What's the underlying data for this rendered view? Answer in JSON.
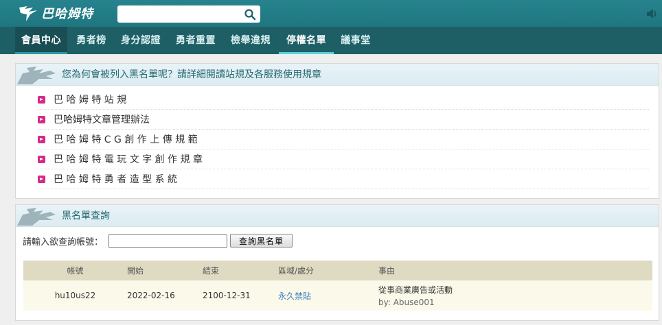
{
  "header": {
    "logo_text": "巴哈姆特",
    "search_placeholder": "",
    "search_value": ""
  },
  "nav": {
    "items": [
      {
        "label": "會員中心"
      },
      {
        "label": "勇者榜"
      },
      {
        "label": "身分認證"
      },
      {
        "label": "勇者重置"
      },
      {
        "label": "檢舉違規"
      },
      {
        "label": "停權名單"
      },
      {
        "label": "議事堂"
      }
    ]
  },
  "rules_panel": {
    "title": "您為何會被列入黑名單呢？請詳細閱讀站規及各服務使用規章",
    "links": [
      "巴 哈 姆 特 站 規",
      "巴哈姆特文章管理辦法",
      "巴 哈 姆 特 C G 創 作 上 傳 規 範",
      "巴 哈 姆 特 電 玩 文 字 創 作 規 章",
      "巴 哈 姆 特 勇 者 造 型 系 統"
    ]
  },
  "blacklist_panel": {
    "title": "黑名單查詢",
    "query_label": "請輸入欲查詢帳號：",
    "query_value": "",
    "query_button": "查詢黑名單",
    "columns": [
      "帳號",
      "開始",
      "結束",
      "區域/處分",
      "事由"
    ],
    "rows": [
      {
        "account": "hu10us22",
        "start": "2022-02-16",
        "end": "2100-12-31",
        "penalty": "永久禁貼",
        "reason": "從事商業廣告或活動",
        "by": "by: Abuse001"
      }
    ]
  },
  "colors": {
    "header": "#26838d",
    "nav": "#1e5f66",
    "accent": "#5dd2da",
    "bullet": "#d62a88",
    "link": "#3b7fbf"
  }
}
